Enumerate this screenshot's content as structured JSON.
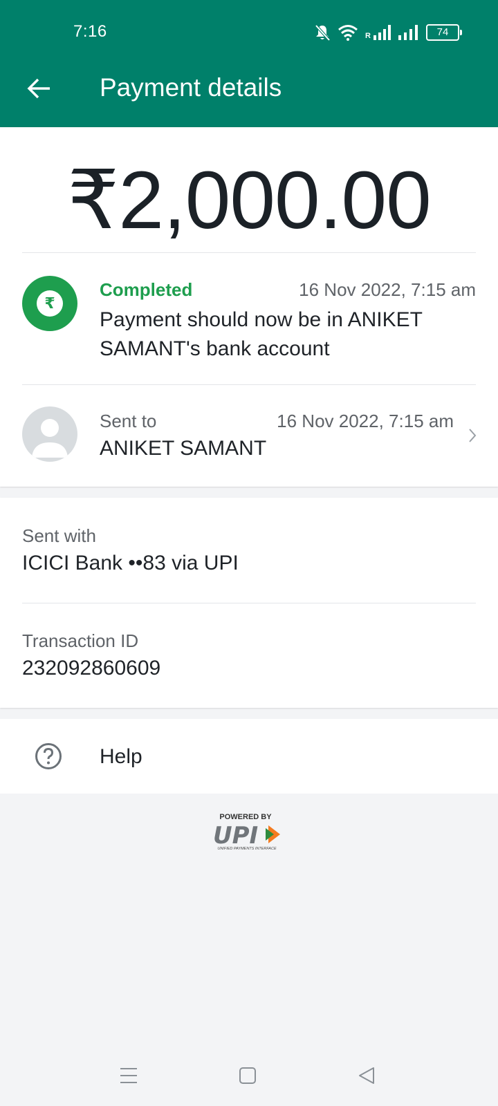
{
  "status_bar": {
    "time": "7:16",
    "battery": "74",
    "network_label": "R"
  },
  "header": {
    "title": "Payment details",
    "back_icon": "arrow-left-icon"
  },
  "payment": {
    "amount": "₹2,000.00",
    "status": {
      "label": "Completed",
      "timestamp": "16 Nov 2022, 7:15 am",
      "message": "Payment should now be in ANIKET SAMANT's bank account",
      "icon": "rupee-icon",
      "color": "#1e9e4e"
    },
    "recipient": {
      "label": "Sent to",
      "timestamp": "16 Nov 2022, 7:15 am",
      "name": "ANIKET SAMANT"
    }
  },
  "details": {
    "sent_with_label": "Sent with",
    "sent_with_value": "ICICI Bank ••83 via UPI",
    "transaction_id_label": "Transaction ID",
    "transaction_id_value": "232092860609"
  },
  "help": {
    "label": "Help"
  },
  "upi_logo": {
    "powered_by": "POWERED BY",
    "mark": "UPI",
    "subtitle": "UNIFIED PAYMENTS INTERFACE"
  },
  "nav": {
    "menu_icon": "menu-icon",
    "home_icon": "home-square-icon",
    "back_icon": "triangle-back-icon"
  },
  "colors": {
    "brand": "#00806a",
    "success": "#1e9e4e",
    "background": "#f3f4f6"
  }
}
